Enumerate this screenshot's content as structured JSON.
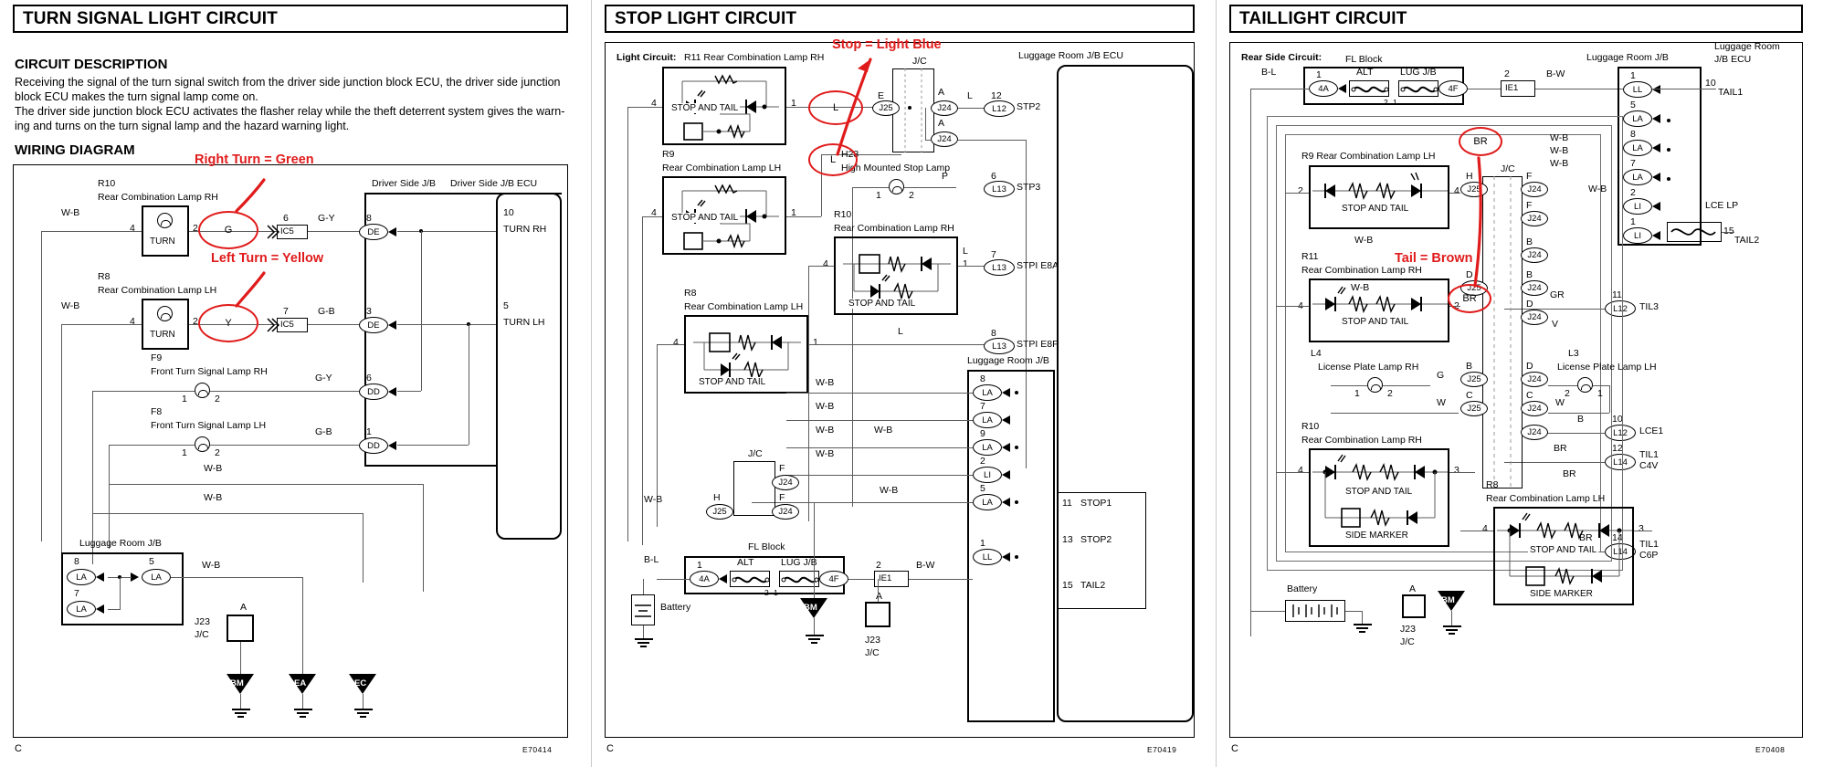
{
  "document": {
    "page_corner_marks": [
      "C",
      "C",
      "C"
    ],
    "doc_codes": [
      "E70414",
      "E70419",
      "E70408"
    ]
  },
  "panels": [
    {
      "id": "turn-signal",
      "title": "TURN SIGNAL LIGHT CIRCUIT",
      "heading_description": "CIRCUIT DESCRIPTION",
      "description_lines": [
        "Receiving the signal of the turn signal switch from the driver side junction block ECU, the driver side junction",
        "block ECU makes the turn signal lamp come on.",
        "The driver side junction block ECU activates the flasher relay while the theft deterrent system gives the warn-",
        "ing and turns on the turn signal lamp and the hazard warning light."
      ],
      "heading_wiring": "WIRING DIAGRAM",
      "annotations": [
        {
          "text": "Right Turn = Green",
          "circle_label": "G"
        },
        {
          "text": "Left Turn = Yellow",
          "circle_label": "Y"
        }
      ],
      "components": [
        {
          "ref": "R10",
          "name": "Rear Combination Lamp RH",
          "inner": "TURN",
          "pins": [
            "4",
            "2"
          ]
        },
        {
          "ref": "R8",
          "name": "Rear Combination Lamp LH",
          "inner": "TURN",
          "pins": [
            "4",
            "2"
          ]
        },
        {
          "ref": "F9",
          "name": "Front Turn Signal Lamp RH",
          "pins": [
            "1",
            "2"
          ]
        },
        {
          "ref": "F8",
          "name": "Front Turn Signal Lamp LH",
          "pins": [
            "1",
            "2"
          ]
        }
      ],
      "blocks": [
        {
          "name": "Driver Side J/B"
        },
        {
          "name": "Driver Side J/B ECU"
        },
        {
          "name": "Luggage Room J/B"
        }
      ],
      "fuses": [
        {
          "pin": "6",
          "label": "IC5"
        },
        {
          "pin": "7",
          "label": "IC5"
        }
      ],
      "wire_colors": [
        "W-B",
        "W-B",
        "G-Y",
        "G-B",
        "G-Y",
        "G-B",
        "W-B",
        "W-B",
        "W-B"
      ],
      "connectors": [
        {
          "pin": "8",
          "label": "DE"
        },
        {
          "pin": "3",
          "label": "DE"
        },
        {
          "pin": "6",
          "label": "DD"
        },
        {
          "pin": "1",
          "label": "DD"
        },
        {
          "pin": "8",
          "label": "LA"
        },
        {
          "pin": "7",
          "label": "LA"
        },
        {
          "pin": "5",
          "label": "LA"
        }
      ],
      "ecu_pins": [
        {
          "pin": "10",
          "signal": "TURN RH"
        },
        {
          "pin": "5",
          "signal": "TURN LH"
        }
      ],
      "junction": {
        "ref": "J23",
        "type": "J/C",
        "terminal": "A"
      },
      "grounds": [
        "BM",
        "EA",
        "EC"
      ]
    },
    {
      "id": "stop-light",
      "title": "STOP LIGHT CIRCUIT",
      "subtitle": "Light Circuit:",
      "annotations": [
        {
          "text": "Stop = Light Blue",
          "circle_labels": [
            "L",
            "L"
          ]
        }
      ],
      "components": [
        {
          "ref": "R11",
          "name": "Rear Combination Lamp RH",
          "inner": "STOP AND TAIL",
          "pins": [
            "4",
            "1"
          ]
        },
        {
          "ref": "R9",
          "name": "Rear Combination Lamp LH",
          "inner": "STOP AND TAIL",
          "pins": [
            "4",
            "1"
          ]
        },
        {
          "ref": "H23",
          "name": "High Mounted Stop Lamp",
          "pins": [
            "1",
            "2"
          ]
        },
        {
          "ref": "R10",
          "name": "Rear Combination Lamp RH",
          "inner": "STOP AND TAIL",
          "pins": [
            "4",
            "1"
          ]
        },
        {
          "ref": "R8",
          "name": "Rear Combination Lamp LH",
          "inner": "STOP AND TAIL",
          "pins": [
            "4",
            "1"
          ]
        }
      ],
      "blocks": [
        {
          "name": "Luggage Room J/B ECU"
        },
        {
          "name": "Luggage Room J/B"
        },
        {
          "name": "FL Block"
        }
      ],
      "junction": {
        "ref": "J/C",
        "terminals": [
          "E",
          "A",
          "A"
        ],
        "connectors": [
          "J25",
          "J24",
          "J24"
        ]
      },
      "j_c_lower": {
        "name": "J/C",
        "terminals": [
          "H",
          "F",
          "F"
        ],
        "connectors": [
          "J25",
          "J24",
          "J24"
        ]
      },
      "ecu_pins": [
        {
          "pin": "12",
          "conn": "L12",
          "signal": "STP2"
        },
        {
          "pin": "6",
          "conn": "L13",
          "signal": "STP3"
        },
        {
          "pin": "7",
          "conn": "L13",
          "signal": "STPI E8A"
        },
        {
          "pin": "8",
          "conn": "L13",
          "signal": "STPI E8F"
        },
        {
          "pin": "11",
          "signal": "STOP1"
        },
        {
          "pin": "13",
          "signal": "STOP2"
        },
        {
          "pin": "15",
          "signal": "TAIL2"
        }
      ],
      "jb_connectors": [
        {
          "pin": "8",
          "label": "LA"
        },
        {
          "pin": "7",
          "label": "LA"
        },
        {
          "pin": "9",
          "label": "LA"
        },
        {
          "pin": "2",
          "label": "LI"
        },
        {
          "pin": "5",
          "label": "LA"
        },
        {
          "pin": "1",
          "label": "LL"
        }
      ],
      "wire_colors": [
        "L",
        "L",
        "P",
        "L",
        "L",
        "W-B",
        "W-B",
        "W-B",
        "W-B",
        "W-B",
        "W-B",
        "W-B",
        "B-L",
        "B-W"
      ],
      "fl_block": {
        "name": "FL Block",
        "items": [
          "ALT",
          "LUG J/B"
        ],
        "in_conn": "4A",
        "out_conn": "4F",
        "pins": [
          "1",
          "1",
          "2",
          "1",
          "2",
          "1"
        ]
      },
      "ie1": {
        "pin": "2",
        "label": "IE1"
      },
      "battery": "Battery",
      "junction_bottom": {
        "ref": "J23",
        "type": "J/C",
        "terminal": "A"
      },
      "grounds": [
        "BM"
      ]
    },
    {
      "id": "taillight",
      "title": "TAILLIGHT CIRCUIT",
      "subtitle": "Rear Side Circuit:",
      "annotations": [
        {
          "text": "Tail = Brown",
          "circle_labels": [
            "BR",
            "BR"
          ]
        }
      ],
      "components": [
        {
          "ref": "R9",
          "name": "Rear Combination Lamp LH",
          "inner": "STOP AND TAIL",
          "pins": [
            "2",
            "4"
          ]
        },
        {
          "ref": "R11",
          "name": "Rear Combination Lamp RH",
          "inner": "STOP AND TAIL",
          "pins": [
            "4",
            "2"
          ]
        },
        {
          "ref": "L4",
          "name": "License Plate Lamp RH",
          "pins": [
            "1",
            "2"
          ]
        },
        {
          "ref": "L3",
          "name": "License Plate Lamp LH",
          "pins": [
            "2",
            "1"
          ]
        },
        {
          "ref": "R10",
          "name": "Rear Combination Lamp RH",
          "inner_top": "STOP AND TAIL",
          "inner_bottom": "SIDE MARKER",
          "pins": [
            "4",
            "3"
          ]
        },
        {
          "ref": "R8",
          "name": "Rear Combination Lamp LH",
          "inner_top": "STOP AND TAIL",
          "inner_bottom": "SIDE MARKER",
          "pins": [
            "4",
            "3"
          ]
        }
      ],
      "blocks": [
        {
          "name": "FL Block"
        },
        {
          "name": "Luggage Room J/B"
        },
        {
          "name": "Luggage Room J/B ECU"
        }
      ],
      "fl_block": {
        "items": [
          "ALT",
          "LUG J/B"
        ],
        "in_conn": "4A",
        "out_conn": "4F",
        "pins": [
          "1",
          "1",
          "2",
          "1",
          "2",
          "1"
        ]
      },
      "ie1": {
        "pin": "2",
        "label": "IE1"
      },
      "jc_connectors_left": [
        "J25",
        "J25",
        "J25",
        "J25",
        "J25"
      ],
      "jc_connectors_right": [
        "J24",
        "J24",
        "J24",
        "J24",
        "J24",
        "J24"
      ],
      "jc_terminals": [
        "H",
        "F",
        "F",
        "B",
        "D",
        "D",
        "B",
        "C",
        "C"
      ],
      "ecu_pins": [
        {
          "pin": "10",
          "conn": "LL",
          "signal": "TAIL1"
        },
        {
          "pin": "15",
          "conn": "LI",
          "signal": "TAIL2"
        },
        {
          "pin": "11",
          "conn": "L12",
          "signal": "TIL3"
        },
        {
          "pin": "10",
          "conn": "L12",
          "signal": "LCE1"
        },
        {
          "pin": "12",
          "conn": "L14",
          "signal": "TIL1 C4V"
        },
        {
          "pin": "14",
          "conn": "L14",
          "signal": "TIL1 C6P"
        }
      ],
      "jb_connectors": [
        {
          "pin": "1",
          "label": "LL"
        },
        {
          "pin": "5",
          "label": "LA"
        },
        {
          "pin": "8",
          "label": "LA"
        },
        {
          "pin": "7",
          "label": "LA"
        },
        {
          "pin": "2",
          "label": "LI"
        },
        {
          "pin": "1",
          "label": "LI"
        }
      ],
      "lce_lp": {
        "label": "LCE LP"
      },
      "wire_colors": [
        "B-L",
        "B-W",
        "W-B",
        "W-B",
        "W-B",
        "W-B",
        "W-B",
        "GR",
        "V",
        "G",
        "W",
        "W",
        "B",
        "B",
        "BR",
        "BR",
        "BR"
      ],
      "battery": "Battery",
      "junction_bottom": {
        "ref": "J23",
        "type": "J/C",
        "terminal": "A"
      },
      "grounds": [
        "BM"
      ]
    }
  ]
}
